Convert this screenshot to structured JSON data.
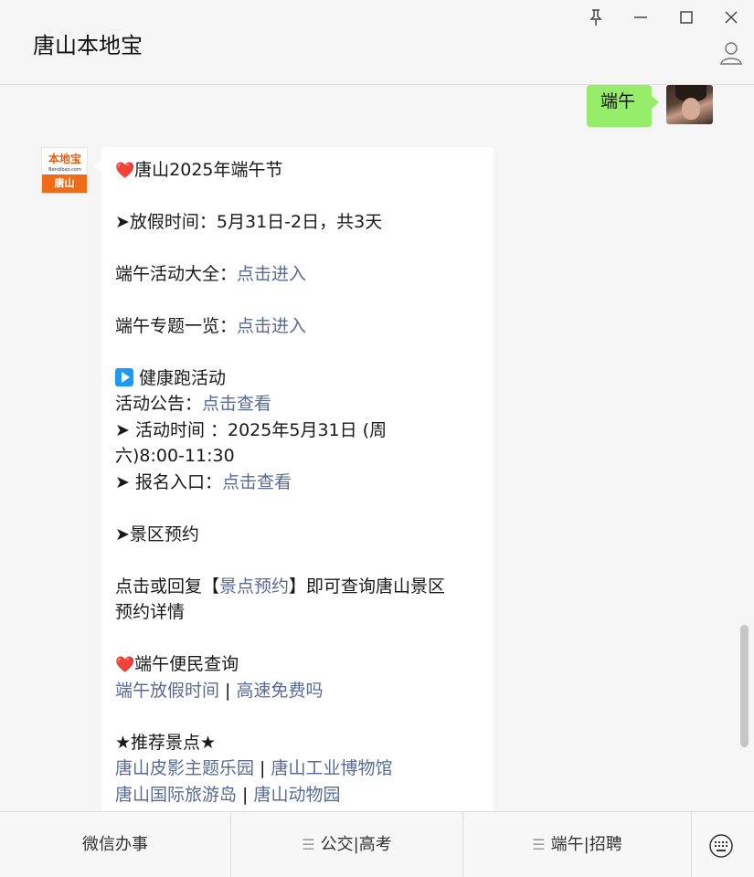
{
  "window": {
    "title": "唐山本地宝",
    "controls": [
      "pin-icon",
      "minimize-icon",
      "maximize-icon",
      "close-icon"
    ]
  },
  "chat": {
    "user_message": "端午",
    "bot_avatar": {
      "logo_text": "本地宝",
      "logo_url": "Bendibao.com",
      "city": "唐山"
    },
    "bot_message": {
      "heading1": "唐山2025年端午节",
      "holiday": "➤放假时间：5月31日-2日，共3天",
      "activities_prefix": "端午活动大全：",
      "activities_link": "点击进入",
      "topics_prefix": "端午专题一览：",
      "topics_link": "点击进入",
      "run_title": "健康跑活动",
      "notice_prefix": "活动公告：",
      "notice_link": "点击查看",
      "time_line1": "➤ 活动时间 ：2025年5月31日 (周",
      "time_line2": "六)8:00-11:30",
      "signup_prefix": "➤ 报名入口：",
      "signup_link": "点击查看",
      "scenic_title": "➤景区预约",
      "reserve_prefix": "点击或回复【",
      "reserve_link": "景点预约",
      "reserve_suffix": "】即可查询唐山景区",
      "reserve_line2": "预约详情",
      "query_title": "端午便民查询",
      "query_link1": "端午放假时间",
      "separator": " | ",
      "query_link2": "高速免费吗",
      "recommend_title": "★推荐景点★",
      "spot1": "唐山皮影主题乐园",
      "spot2": "唐山工业博物馆",
      "spot3": "唐山国际旅游岛",
      "spot4": "唐山动物园"
    }
  },
  "bottom_menu": {
    "items": [
      "微信办事",
      "公交|高考",
      "端午|招聘"
    ],
    "keyboard_icon": "keyboard-icon"
  },
  "colors": {
    "user_bubble": "#95ec69",
    "link": "#576b95",
    "heart": "#e8232d",
    "logo_orange": "#f06b18"
  }
}
